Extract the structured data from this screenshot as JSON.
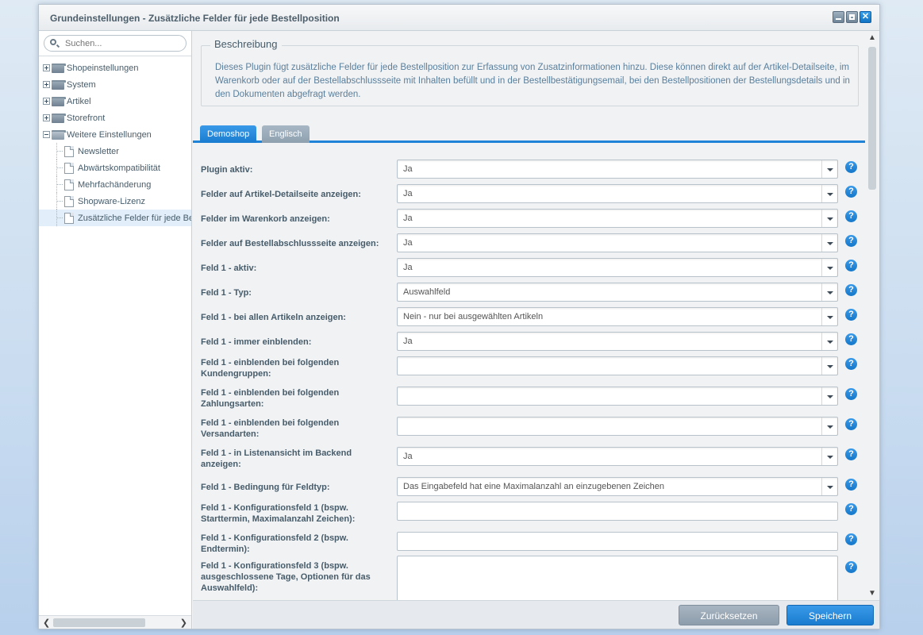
{
  "window": {
    "title": "Grundeinstellungen - Zusätzliche Felder für jede Bestellposition"
  },
  "search": {
    "placeholder": "Suchen..."
  },
  "tree": [
    {
      "label": "Shopeinstellungen",
      "type": "folder",
      "expanded": false
    },
    {
      "label": "System",
      "type": "folder",
      "expanded": false
    },
    {
      "label": "Artikel",
      "type": "folder",
      "expanded": false
    },
    {
      "label": "Storefront",
      "type": "folder",
      "expanded": false
    },
    {
      "label": "Weitere Einstellungen",
      "type": "folder",
      "expanded": true
    },
    {
      "label": "Newsletter",
      "type": "doc"
    },
    {
      "label": "Abwärtskompatibilität",
      "type": "doc"
    },
    {
      "label": "Mehrfachänderung",
      "type": "doc"
    },
    {
      "label": "Shopware-Lizenz",
      "type": "doc"
    },
    {
      "label": "Zusätzliche Felder für jede Bestellposition",
      "type": "doc",
      "selected": true
    }
  ],
  "description": {
    "legend": "Beschreibung",
    "text": "Dieses Plugin fügt zusätzliche Felder für jede Bestellposition zur Erfassung von Zusatzinformationen hinzu. Diese können direkt auf der Artikel-Detailseite, im Warenkorb oder auf der Bestellabschlussseite mit Inhalten befüllt und in der Bestellbestätigungsemail, bei den Bestellpositionen der Bestellungsdetails und in den Dokumenten abgefragt werden."
  },
  "tabs": [
    {
      "label": "Demoshop",
      "active": true
    },
    {
      "label": "Englisch",
      "active": false
    }
  ],
  "fields": [
    {
      "label": "Plugin aktiv:",
      "type": "combo",
      "value": "Ja"
    },
    {
      "label": "Felder auf Artikel-Detailseite anzeigen:",
      "type": "combo",
      "value": "Ja"
    },
    {
      "label": "Felder im Warenkorb anzeigen:",
      "type": "combo",
      "value": "Ja"
    },
    {
      "label": "Felder auf Bestellabschlussseite anzeigen:",
      "type": "combo",
      "value": "Ja"
    },
    {
      "label": "Feld 1 - aktiv:",
      "type": "combo",
      "value": "Ja"
    },
    {
      "label": "Feld 1 - Typ:",
      "type": "combo",
      "value": "Auswahlfeld"
    },
    {
      "label": "Feld 1 - bei allen Artikeln anzeigen:",
      "type": "combo",
      "value": "Nein - nur bei ausgewählten Artikeln"
    },
    {
      "label": "Feld 1 - immer einblenden:",
      "type": "combo",
      "value": "Ja"
    },
    {
      "label": "Feld 1 - einblenden bei folgenden Kundengruppen:",
      "type": "combo",
      "value": ""
    },
    {
      "label": "Feld 1 - einblenden bei folgenden Zahlungsarten:",
      "type": "combo",
      "value": ""
    },
    {
      "label": "Feld 1 - einblenden bei folgenden Versandarten:",
      "type": "combo",
      "value": ""
    },
    {
      "label": "Feld 1 - in Listenansicht im Backend anzeigen:",
      "type": "combo",
      "value": "Ja"
    },
    {
      "label": "Feld 1 - Bedingung für Feldtyp:",
      "type": "combo",
      "value": "Das Eingabefeld hat eine Maximalanzahl an einzugebenen Zeichen"
    },
    {
      "label": "Feld 1 - Konfigurationsfeld 1 (bspw. Starttermin, Maximalanzahl Zeichen):",
      "type": "text",
      "value": ""
    },
    {
      "label": "Feld 1 - Konfigurationsfeld 2 (bspw. Endtermin):",
      "type": "text",
      "value": ""
    },
    {
      "label": "Feld 1 - Konfigurationsfeld 3 (bspw. ausgeschlossene Tage, Optionen für das Auswahlfeld):",
      "type": "textarea",
      "value": ""
    }
  ],
  "help_glyph": "?",
  "buttons": {
    "reset": "Zurücksetzen",
    "save": "Speichern"
  },
  "colors": {
    "accent": "#1f83d8",
    "button_gray": "#9aa8b6"
  }
}
